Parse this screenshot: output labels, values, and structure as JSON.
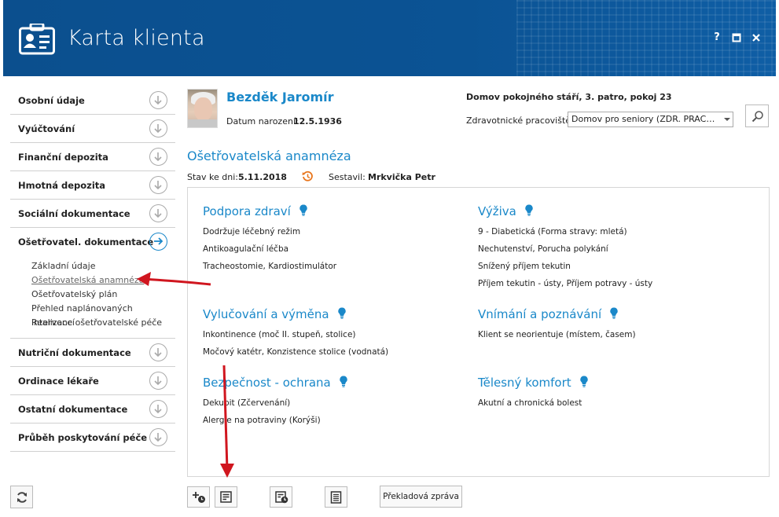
{
  "window": {
    "title": "Karta klienta",
    "buttons": {
      "help": "?",
      "maximize": "",
      "close": "✕"
    }
  },
  "sidebar": {
    "items": [
      {
        "label": "Osobní údaje"
      },
      {
        "label": "Vyúčtování"
      },
      {
        "label": "Finanční depozita"
      },
      {
        "label": "Hmotná depozita"
      },
      {
        "label": "Sociální dokumentace"
      },
      {
        "label": "Ošetřovatel. dokumentace"
      }
    ],
    "subitems": [
      {
        "label": "Základní údaje"
      },
      {
        "label": "Ošetřovatelská anamnéza"
      },
      {
        "label": "Ošetřovatelský plán"
      },
      {
        "label": "Přehled naplánovaných intervencí"
      },
      {
        "label": "Realizace ošetřovatelské péče"
      }
    ],
    "items_after": [
      {
        "label": "Nutriční dokumentace"
      },
      {
        "label": "Ordinace lékaře"
      },
      {
        "label": "Ostatní dokumentace"
      },
      {
        "label": "Průběh poskytování péče"
      }
    ]
  },
  "client": {
    "name": "Bezděk Jaromír",
    "dob_label": "Datum narození:",
    "dob": "12.5.1936",
    "location": "Domov pokojného stáří, 3. patro, pokoj 23",
    "workplace_label": "Zdravotnické pracoviště:",
    "workplace_value": "Domov pro seniory (ZDR. PRACOVIŠ..."
  },
  "section": {
    "title": "Ošetřovatelská anamnéza",
    "stav_label": "Stav ke dni:",
    "stav_value": "5.11.2018",
    "sestavil_label": "Sestavil:",
    "sestavil_value": "Mrkvička Petr"
  },
  "categories": [
    {
      "title": "Podpora zdraví",
      "items": [
        "Dodržuje léčebný režim",
        "Antikoagulační léčba",
        "Tracheostomie, Kardiostimulátor"
      ]
    },
    {
      "title": "Výživa",
      "items": [
        "9 - Diabetická (Forma stravy: mletá)",
        "Nechutenství, Porucha polykání",
        "Snížený příjem tekutin",
        "Příjem tekutin - ústy, Příjem potravy - ústy"
      ]
    },
    {
      "title": "Vylučování a výměna",
      "items": [
        "Inkontinence (moč II. stupeň, stolice)",
        "Močový katétr, Konzistence stolice (vodnatá)"
      ]
    },
    {
      "title": "Vnímání a poznávání",
      "items": [
        "Klient se neorientuje (místem, časem)"
      ]
    },
    {
      "title": "Bezpečnost - ochrana",
      "items": [
        "Dekubit (Zčervenání)",
        "Alergie na potraviny (Korýši)"
      ]
    },
    {
      "title": "Tělesný komfort",
      "items": [
        "Akutní a chronická bolest"
      ]
    }
  ],
  "toolbar": {
    "report_label": "Překladová zpráva"
  },
  "colors": {
    "header": "#0b5394",
    "accent": "#1a88c9",
    "annotation": "#d0161f"
  }
}
